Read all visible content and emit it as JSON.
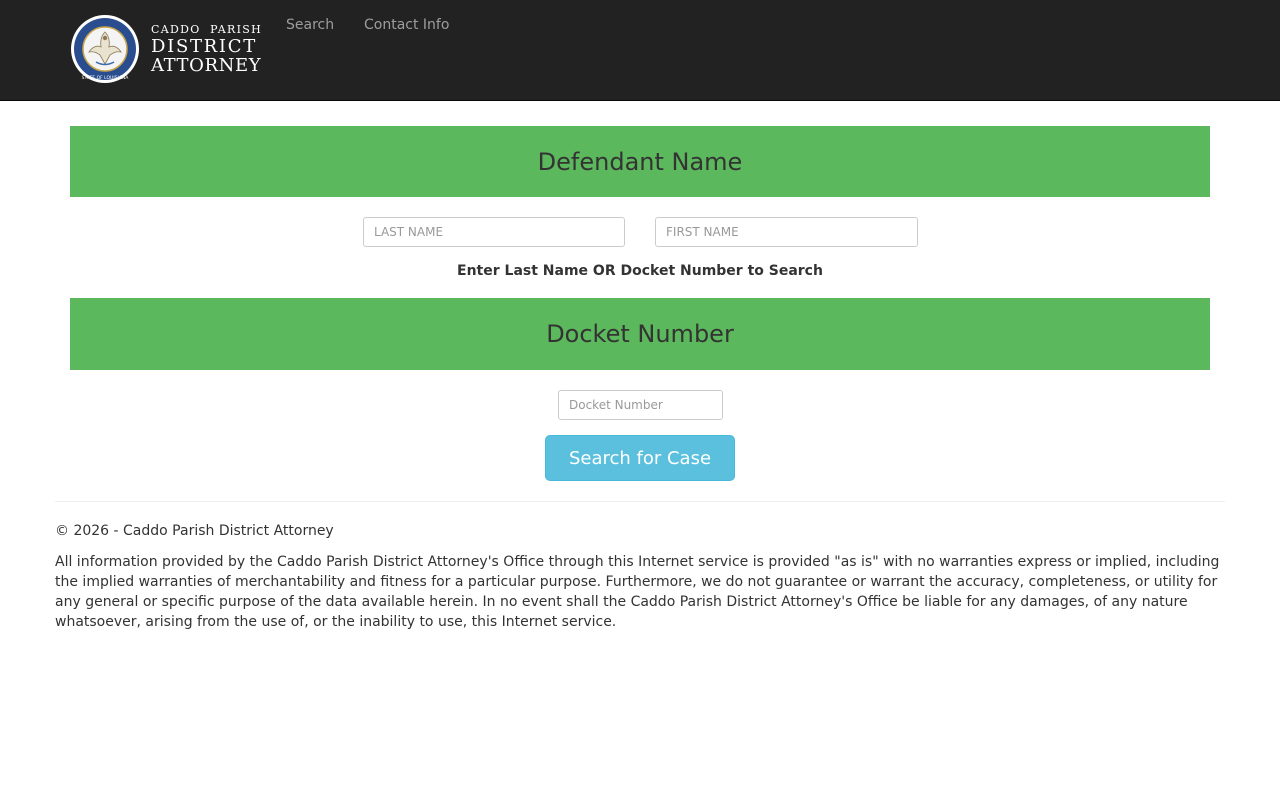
{
  "navbar": {
    "brand": {
      "line1": "CADDO  PARISH",
      "line2": "DISTRICT",
      "line3": "ATTORNEY",
      "seal_text": "STATE OF LOUISIANA"
    },
    "links": [
      {
        "label": "Search"
      },
      {
        "label": "Contact Info"
      }
    ]
  },
  "defendant_section": {
    "title": "Defendant Name",
    "last_name_placeholder": "LAST NAME",
    "first_name_placeholder": "FIRST NAME"
  },
  "hint": "Enter Last Name OR Docket Number to Search",
  "docket_section": {
    "title": "Docket Number",
    "docket_placeholder": "Docket Number"
  },
  "search_button": "Search for Case",
  "footer": {
    "copyright": "© 2026 - Caddo Parish District Attorney",
    "disclaimer": "All information provided by the Caddo Parish District Attorney's Office through this Internet service is provided \"as is\" with no warranties express or implied, including the implied warranties of merchantability and fitness for a particular purpose. Furthermore, we do not guarantee or warrant the accuracy, completeness, or utility for any general or specific purpose of the data available herein. In no event shall the Caddo Parish District Attorney's Office be liable for any damages, of any nature whatsoever, arising from the use of, or the inability to use, this Internet service."
  },
  "colors": {
    "navbar_bg": "#222222",
    "section_header_bg": "#5cb85c",
    "button_bg": "#5bc0de"
  }
}
